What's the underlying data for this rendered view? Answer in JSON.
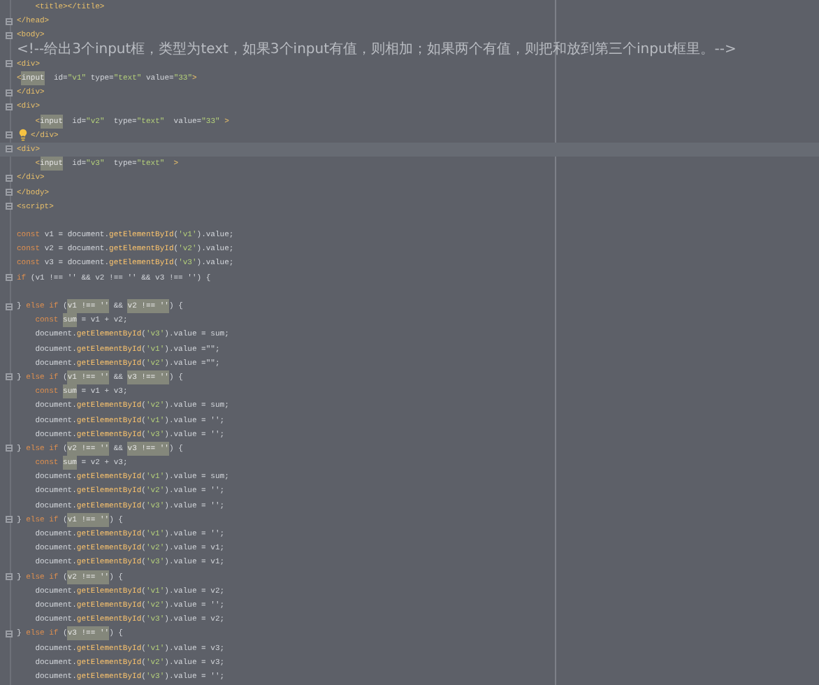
{
  "editor": {
    "lines": [
      {
        "fold": false,
        "current": false,
        "tokens": [
          {
            "kind": "tag",
            "text": "    <title></title>"
          }
        ]
      },
      {
        "fold": true,
        "current": false,
        "tokens": [
          {
            "kind": "tag",
            "text": "</head>"
          }
        ]
      },
      {
        "fold": true,
        "current": false,
        "tokens": [
          {
            "kind": "tag",
            "text": "<body>"
          }
        ]
      },
      {
        "fold": false,
        "current": false,
        "tokens": [
          {
            "kind": "comment",
            "text": "<!--给出3个input框，类型为text，如果3个input有值，则相加；如果两个有值，则把和放到第三个input框里。-->"
          }
        ]
      },
      {
        "fold": true,
        "current": false,
        "tokens": [
          {
            "kind": "tag",
            "text": "<div>"
          }
        ]
      },
      {
        "fold": false,
        "current": false,
        "tokens": [
          {
            "kind": "tag",
            "text": "<"
          },
          {
            "kind": "match",
            "text": "input"
          },
          {
            "kind": "plain",
            "text": "  id="
          },
          {
            "kind": "string",
            "text": "\"v1\""
          },
          {
            "kind": "plain",
            "text": " type="
          },
          {
            "kind": "string",
            "text": "\"text\""
          },
          {
            "kind": "plain",
            "text": " value="
          },
          {
            "kind": "string",
            "text": "\"33\""
          },
          {
            "kind": "tag",
            "text": ">"
          }
        ]
      },
      {
        "fold": true,
        "current": false,
        "tokens": [
          {
            "kind": "tag",
            "text": "</div>"
          }
        ]
      },
      {
        "fold": true,
        "current": false,
        "tokens": [
          {
            "kind": "tag",
            "text": "<div>"
          }
        ]
      },
      {
        "fold": false,
        "current": false,
        "tokens": [
          {
            "kind": "tag",
            "text": "    <"
          },
          {
            "kind": "match",
            "text": "input"
          },
          {
            "kind": "plain",
            "text": "  id="
          },
          {
            "kind": "string",
            "text": "\"v2\""
          },
          {
            "kind": "plain",
            "text": "  type="
          },
          {
            "kind": "string",
            "text": "\"text\""
          },
          {
            "kind": "plain",
            "text": "  value="
          },
          {
            "kind": "string",
            "text": "\"33\""
          },
          {
            "kind": "tag",
            "text": " >"
          }
        ]
      },
      {
        "fold": true,
        "current": false,
        "tokens": [
          {
            "kind": "bulb"
          },
          {
            "kind": "tag",
            "text": "</div>"
          }
        ]
      },
      {
        "fold": true,
        "current": true,
        "tokens": [
          {
            "kind": "tag",
            "text": "<div>"
          }
        ]
      },
      {
        "fold": false,
        "current": false,
        "tokens": [
          {
            "kind": "tag",
            "text": "    <"
          },
          {
            "kind": "match",
            "text": "input"
          },
          {
            "kind": "plain",
            "text": "  id="
          },
          {
            "kind": "string",
            "text": "\"v3\""
          },
          {
            "kind": "plain",
            "text": "  type="
          },
          {
            "kind": "string",
            "text": "\"text\""
          },
          {
            "kind": "tag",
            "text": "  >"
          }
        ]
      },
      {
        "fold": true,
        "current": false,
        "tokens": [
          {
            "kind": "tag",
            "text": "</div>"
          }
        ]
      },
      {
        "fold": true,
        "current": false,
        "tokens": [
          {
            "kind": "tag",
            "text": "</body>"
          }
        ]
      },
      {
        "fold": true,
        "current": false,
        "tokens": [
          {
            "kind": "tag",
            "text": "<script>"
          }
        ]
      },
      {
        "fold": false,
        "current": false
      },
      {
        "fold": false,
        "current": false,
        "tokens": [
          {
            "kind": "keyword",
            "text": "const"
          },
          {
            "kind": "plain",
            "text": " v1 = document."
          },
          {
            "kind": "function",
            "text": "getElementById"
          },
          {
            "kind": "plain",
            "text": "("
          },
          {
            "kind": "string",
            "text": "'v1'"
          },
          {
            "kind": "plain",
            "text": ").value;"
          }
        ]
      },
      {
        "fold": false,
        "current": false,
        "tokens": [
          {
            "kind": "keyword",
            "text": "const"
          },
          {
            "kind": "plain",
            "text": " v2 = document."
          },
          {
            "kind": "function",
            "text": "getElementById"
          },
          {
            "kind": "plain",
            "text": "("
          },
          {
            "kind": "string",
            "text": "'v2'"
          },
          {
            "kind": "plain",
            "text": ").value;"
          }
        ]
      },
      {
        "fold": false,
        "current": false,
        "tokens": [
          {
            "kind": "keyword",
            "text": "const"
          },
          {
            "kind": "plain",
            "text": " v3 = document."
          },
          {
            "kind": "function",
            "text": "getElementById"
          },
          {
            "kind": "plain",
            "text": "("
          },
          {
            "kind": "string",
            "text": "'v3'"
          },
          {
            "kind": "plain",
            "text": ").value;"
          }
        ]
      },
      {
        "fold": true,
        "current": false,
        "tokens": [
          {
            "kind": "keyword",
            "text": "if"
          },
          {
            "kind": "plain",
            "text": " (v1 !== '' && v2 !== '' && v3 !== '') {"
          }
        ]
      },
      {
        "fold": false,
        "current": false
      },
      {
        "fold": true,
        "current": false,
        "tokens": [
          {
            "kind": "plain",
            "text": "} "
          },
          {
            "kind": "keyword",
            "text": "else if"
          },
          {
            "kind": "plain",
            "text": " ("
          },
          {
            "kind": "match",
            "text": "v1 !== ''"
          },
          {
            "kind": "plain",
            "text": " && "
          },
          {
            "kind": "match",
            "text": "v2 !== ''"
          },
          {
            "kind": "plain",
            "text": ") {"
          }
        ]
      },
      {
        "fold": false,
        "current": false,
        "tokens": [
          {
            "kind": "keyword",
            "text": "    const "
          },
          {
            "kind": "match",
            "text": "sum"
          },
          {
            "kind": "plain",
            "text": " = v1 + v2;"
          }
        ]
      },
      {
        "fold": false,
        "current": false,
        "tokens": [
          {
            "kind": "plain",
            "text": "    document."
          },
          {
            "kind": "function",
            "text": "getElementById"
          },
          {
            "kind": "plain",
            "text": "("
          },
          {
            "kind": "string",
            "text": "'v3'"
          },
          {
            "kind": "plain",
            "text": ").value = sum;"
          }
        ]
      },
      {
        "fold": false,
        "current": false,
        "tokens": [
          {
            "kind": "plain",
            "text": "    document."
          },
          {
            "kind": "function",
            "text": "getElementById"
          },
          {
            "kind": "plain",
            "text": "("
          },
          {
            "kind": "string",
            "text": "'v1'"
          },
          {
            "kind": "plain",
            "text": ").value =\"\";"
          }
        ]
      },
      {
        "fold": false,
        "current": false,
        "tokens": [
          {
            "kind": "plain",
            "text": "    document."
          },
          {
            "kind": "function",
            "text": "getElementById"
          },
          {
            "kind": "plain",
            "text": "("
          },
          {
            "kind": "string",
            "text": "'v2'"
          },
          {
            "kind": "plain",
            "text": ").value =\"\";"
          }
        ]
      },
      {
        "fold": true,
        "current": false,
        "tokens": [
          {
            "kind": "plain",
            "text": "} "
          },
          {
            "kind": "keyword",
            "text": "else if"
          },
          {
            "kind": "plain",
            "text": " ("
          },
          {
            "kind": "match",
            "text": "v1 !== ''"
          },
          {
            "kind": "plain",
            "text": " && "
          },
          {
            "kind": "match",
            "text": "v3 !== ''"
          },
          {
            "kind": "plain",
            "text": ") {"
          }
        ]
      },
      {
        "fold": false,
        "current": false,
        "tokens": [
          {
            "kind": "keyword",
            "text": "    const "
          },
          {
            "kind": "match",
            "text": "sum"
          },
          {
            "kind": "plain",
            "text": " = v1 + v3;"
          }
        ]
      },
      {
        "fold": false,
        "current": false,
        "tokens": [
          {
            "kind": "plain",
            "text": "    document."
          },
          {
            "kind": "function",
            "text": "getElementById"
          },
          {
            "kind": "plain",
            "text": "("
          },
          {
            "kind": "string",
            "text": "'v2'"
          },
          {
            "kind": "plain",
            "text": ").value = sum;"
          }
        ]
      },
      {
        "fold": false,
        "current": false,
        "tokens": [
          {
            "kind": "plain",
            "text": "    document."
          },
          {
            "kind": "function",
            "text": "getElementById"
          },
          {
            "kind": "plain",
            "text": "("
          },
          {
            "kind": "string",
            "text": "'v1'"
          },
          {
            "kind": "plain",
            "text": ").value = '';"
          }
        ]
      },
      {
        "fold": false,
        "current": false,
        "tokens": [
          {
            "kind": "plain",
            "text": "    document."
          },
          {
            "kind": "function",
            "text": "getElementById"
          },
          {
            "kind": "plain",
            "text": "("
          },
          {
            "kind": "string",
            "text": "'v3'"
          },
          {
            "kind": "plain",
            "text": ").value = '';"
          }
        ]
      },
      {
        "fold": true,
        "current": false,
        "tokens": [
          {
            "kind": "plain",
            "text": "} "
          },
          {
            "kind": "keyword",
            "text": "else if"
          },
          {
            "kind": "plain",
            "text": " ("
          },
          {
            "kind": "match",
            "text": "v2 !== ''"
          },
          {
            "kind": "plain",
            "text": " && "
          },
          {
            "kind": "match",
            "text": "v3 !== ''"
          },
          {
            "kind": "plain",
            "text": ") {"
          }
        ]
      },
      {
        "fold": false,
        "current": false,
        "tokens": [
          {
            "kind": "keyword",
            "text": "    const "
          },
          {
            "kind": "match",
            "text": "sum"
          },
          {
            "kind": "plain",
            "text": " = v2 + v3;"
          }
        ]
      },
      {
        "fold": false,
        "current": false,
        "tokens": [
          {
            "kind": "plain",
            "text": "    document."
          },
          {
            "kind": "function",
            "text": "getElementById"
          },
          {
            "kind": "plain",
            "text": "("
          },
          {
            "kind": "string",
            "text": "'v1'"
          },
          {
            "kind": "plain",
            "text": ").value = sum;"
          }
        ]
      },
      {
        "fold": false,
        "current": false,
        "tokens": [
          {
            "kind": "plain",
            "text": "    document."
          },
          {
            "kind": "function",
            "text": "getElementById"
          },
          {
            "kind": "plain",
            "text": "("
          },
          {
            "kind": "string",
            "text": "'v2'"
          },
          {
            "kind": "plain",
            "text": ").value = '';"
          }
        ]
      },
      {
        "fold": false,
        "current": false,
        "tokens": [
          {
            "kind": "plain",
            "text": "    document."
          },
          {
            "kind": "function",
            "text": "getElementById"
          },
          {
            "kind": "plain",
            "text": "("
          },
          {
            "kind": "string",
            "text": "'v3'"
          },
          {
            "kind": "plain",
            "text": ").value = '';"
          }
        ]
      },
      {
        "fold": true,
        "current": false,
        "tokens": [
          {
            "kind": "plain",
            "text": "} "
          },
          {
            "kind": "keyword",
            "text": "else if"
          },
          {
            "kind": "plain",
            "text": " ("
          },
          {
            "kind": "match",
            "text": "v1 !== ''"
          },
          {
            "kind": "plain",
            "text": ") {"
          }
        ]
      },
      {
        "fold": false,
        "current": false,
        "tokens": [
          {
            "kind": "plain",
            "text": "    document."
          },
          {
            "kind": "function",
            "text": "getElementById"
          },
          {
            "kind": "plain",
            "text": "("
          },
          {
            "kind": "string",
            "text": "'v1'"
          },
          {
            "kind": "plain",
            "text": ").value = '';"
          }
        ]
      },
      {
        "fold": false,
        "current": false,
        "tokens": [
          {
            "kind": "plain",
            "text": "    document."
          },
          {
            "kind": "function",
            "text": "getElementById"
          },
          {
            "kind": "plain",
            "text": "("
          },
          {
            "kind": "string",
            "text": "'v2'"
          },
          {
            "kind": "plain",
            "text": ").value = v1;"
          }
        ]
      },
      {
        "fold": false,
        "current": false,
        "tokens": [
          {
            "kind": "plain",
            "text": "    document."
          },
          {
            "kind": "function",
            "text": "getElementById"
          },
          {
            "kind": "plain",
            "text": "("
          },
          {
            "kind": "string",
            "text": "'v3'"
          },
          {
            "kind": "plain",
            "text": ").value = v1;"
          }
        ]
      },
      {
        "fold": true,
        "current": false,
        "tokens": [
          {
            "kind": "plain",
            "text": "} "
          },
          {
            "kind": "keyword",
            "text": "else if"
          },
          {
            "kind": "plain",
            "text": " ("
          },
          {
            "kind": "match",
            "text": "v2 !== ''"
          },
          {
            "kind": "plain",
            "text": ") {"
          }
        ]
      },
      {
        "fold": false,
        "current": false,
        "tokens": [
          {
            "kind": "plain",
            "text": "    document."
          },
          {
            "kind": "function",
            "text": "getElementById"
          },
          {
            "kind": "plain",
            "text": "("
          },
          {
            "kind": "string",
            "text": "'v1'"
          },
          {
            "kind": "plain",
            "text": ").value = v2;"
          }
        ]
      },
      {
        "fold": false,
        "current": false,
        "tokens": [
          {
            "kind": "plain",
            "text": "    document."
          },
          {
            "kind": "function",
            "text": "getElementById"
          },
          {
            "kind": "plain",
            "text": "("
          },
          {
            "kind": "string",
            "text": "'v2'"
          },
          {
            "kind": "plain",
            "text": ").value = '';"
          }
        ]
      },
      {
        "fold": false,
        "current": false,
        "tokens": [
          {
            "kind": "plain",
            "text": "    document."
          },
          {
            "kind": "function",
            "text": "getElementById"
          },
          {
            "kind": "plain",
            "text": "("
          },
          {
            "kind": "string",
            "text": "'v3'"
          },
          {
            "kind": "plain",
            "text": ").value = v2;"
          }
        ]
      },
      {
        "fold": true,
        "current": false,
        "tokens": [
          {
            "kind": "plain",
            "text": "} "
          },
          {
            "kind": "keyword",
            "text": "else if"
          },
          {
            "kind": "plain",
            "text": " ("
          },
          {
            "kind": "match",
            "text": "v3 !== ''"
          },
          {
            "kind": "plain",
            "text": ") {"
          }
        ]
      },
      {
        "fold": false,
        "current": false,
        "tokens": [
          {
            "kind": "plain",
            "text": "    document."
          },
          {
            "kind": "function",
            "text": "getElementById"
          },
          {
            "kind": "plain",
            "text": "("
          },
          {
            "kind": "string",
            "text": "'v1'"
          },
          {
            "kind": "plain",
            "text": ").value = v3;"
          }
        ]
      },
      {
        "fold": false,
        "current": false,
        "tokens": [
          {
            "kind": "plain",
            "text": "    document."
          },
          {
            "kind": "function",
            "text": "getElementById"
          },
          {
            "kind": "plain",
            "text": "("
          },
          {
            "kind": "string",
            "text": "'v2'"
          },
          {
            "kind": "plain",
            "text": ").value = v3;"
          }
        ]
      },
      {
        "fold": false,
        "current": false,
        "tokens": [
          {
            "kind": "plain",
            "text": "    document."
          },
          {
            "kind": "function",
            "text": "getElementById"
          },
          {
            "kind": "plain",
            "text": "("
          },
          {
            "kind": "string",
            "text": "'v3'"
          },
          {
            "kind": "plain",
            "text": ").value = '';"
          }
        ]
      }
    ]
  }
}
